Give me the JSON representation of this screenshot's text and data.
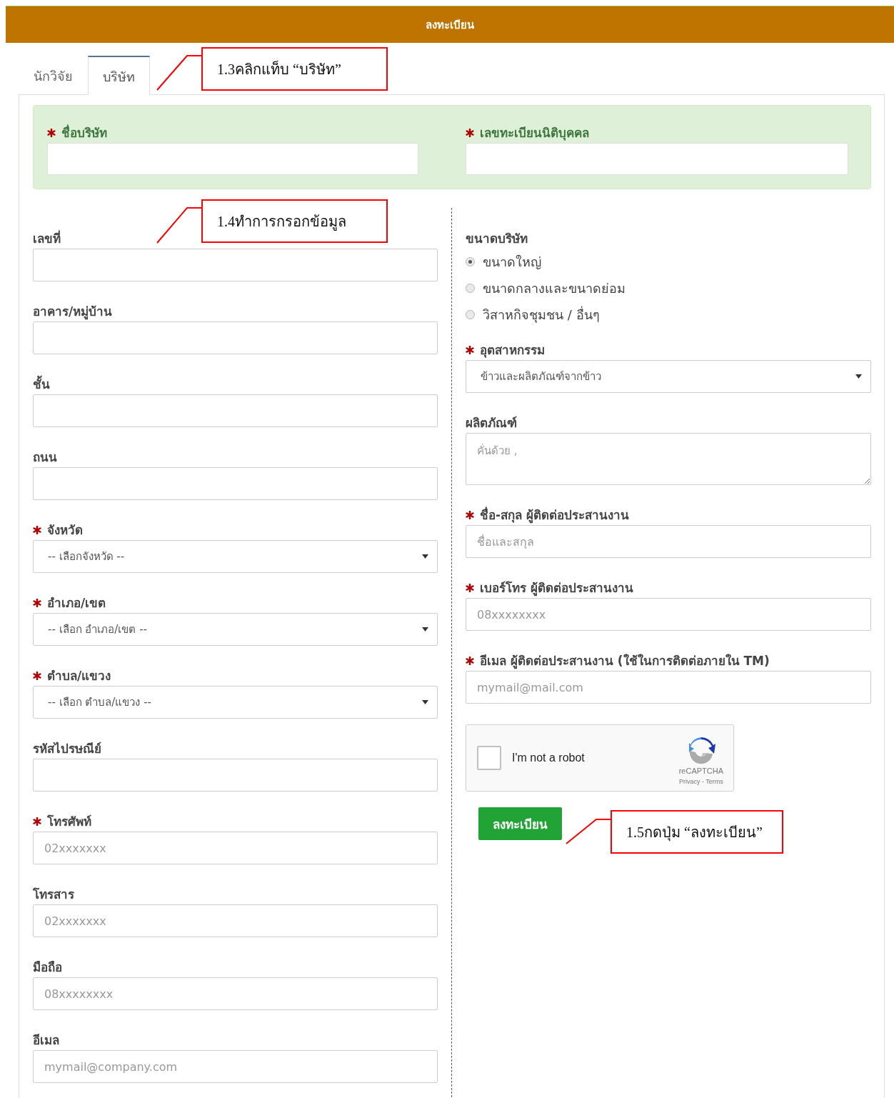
{
  "header": {
    "title": "ลงทะเบียน"
  },
  "tabs": [
    {
      "label": "นักวิจัย",
      "selected": false
    },
    {
      "label": "บริษัท",
      "selected": true
    }
  ],
  "primary_fields": [
    {
      "label": "ชื่อบริษัท",
      "required": true
    },
    {
      "label": "เลขทะเบียนนิติบุคคล",
      "required": true
    }
  ],
  "left_fields": [
    {
      "kind": "input",
      "label": "เลขที่",
      "required": false
    },
    {
      "kind": "input",
      "label": "อาคาร/หมู่บ้าน",
      "required": false
    },
    {
      "kind": "input",
      "label": "ชั้น",
      "required": false
    },
    {
      "kind": "input",
      "label": "ถนน",
      "required": false
    },
    {
      "kind": "select",
      "label": "จังหวัด",
      "required": true,
      "value": "-- เลือกจังหวัด --"
    },
    {
      "kind": "select",
      "label": "อำเภอ/เขต",
      "required": true,
      "value": "-- เลือก อำเภอ/เขต --"
    },
    {
      "kind": "select",
      "label": "ตำบล/แขวง",
      "required": true,
      "value": "-- เลือก ตำบล/แขวง --"
    },
    {
      "kind": "input",
      "label": "รหัสไปรษณีย์",
      "required": false
    },
    {
      "kind": "input",
      "label": "โทรศัพท์",
      "required": true,
      "placeholder": "02xxxxxxx"
    },
    {
      "kind": "input",
      "label": "โทรสาร",
      "required": false,
      "placeholder": "02xxxxxxx"
    },
    {
      "kind": "input",
      "label": "มือถือ",
      "required": false,
      "placeholder": "08xxxxxxxx"
    },
    {
      "kind": "input",
      "label": "อีเมล",
      "required": false,
      "placeholder": "mymail@company.com"
    }
  ],
  "company_size": {
    "label": "ขนาดบริษัท",
    "options": [
      {
        "label": "ขนาดใหญ่",
        "selected": true
      },
      {
        "label": "ขนาดกลางและขนาดย่อม",
        "selected": false
      },
      {
        "label": "วิสาหกิจชุมชน / อื่นๆ",
        "selected": false
      }
    ]
  },
  "right_fields": [
    {
      "kind": "select",
      "label": "อุตสาหกรรม",
      "required": true,
      "value": "ข้าวและผลิตภัณฑ์จากข้าว"
    },
    {
      "kind": "textarea",
      "label": "ผลิตภัณฑ์",
      "required": false,
      "placeholder": "คั่นด้วย ,"
    },
    {
      "kind": "input",
      "label": "ชื่อ-สกุล ผู้ติดต่อประสานงาน",
      "required": true,
      "placeholder": "ชื่อและสกุล"
    },
    {
      "kind": "input",
      "label": "เบอร์โทร ผู้ติดต่อประสานงาน",
      "required": true,
      "placeholder": "08xxxxxxxx"
    },
    {
      "kind": "input",
      "label": "อีเมล ผู้ติดต่อประสานงาน (ใช้ในการติดต่อภายใน TM)",
      "required": true,
      "placeholder": "mymail@mail.com"
    }
  ],
  "captcha": {
    "label": "I'm not a robot",
    "checked": false,
    "brand": "reCAPTCHA",
    "links": "Privacy - Terms"
  },
  "submit_button": {
    "label": "ลงทะเบียน"
  },
  "annotations": [
    {
      "text": "1.3คลิกแท็บ “บริษัท”"
    },
    {
      "text": "1.4ทำการกรอกข้อมูล"
    },
    {
      "text": "1.5กดปุ่ม “ลงทะเบียน”"
    }
  ]
}
